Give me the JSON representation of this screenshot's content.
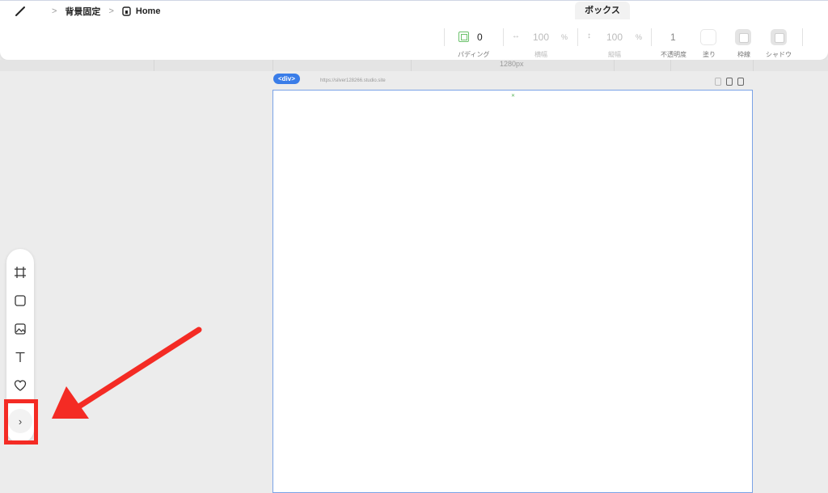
{
  "breadcrumb": {
    "items": [
      "背景固定",
      "Home"
    ]
  },
  "tabs": {
    "active": "ボックス"
  },
  "toolbar": {
    "padding": {
      "value": "0",
      "label": "パディング"
    },
    "width": {
      "value": "100",
      "unit": "%",
      "label": "横幅"
    },
    "height": {
      "value": "100",
      "unit": "%",
      "label": "縦幅"
    },
    "opacity": {
      "value": "1",
      "label": "不透明度"
    },
    "fill": {
      "label": "塗り"
    },
    "border": {
      "label": "枠線"
    },
    "shadow": {
      "label": "シャドウ"
    }
  },
  "ruler": {
    "label": "1280px"
  },
  "canvas": {
    "element_tag": "<div>",
    "url": "https://silver128266.studio.site"
  },
  "palette": {
    "items": [
      "frame-icon",
      "box-icon",
      "image-icon",
      "text-icon",
      "heart-icon"
    ],
    "expand_label": "›"
  },
  "colors": {
    "accent": "#3a7de8",
    "highlight": "#f42b24",
    "padding_icon": "#6cc26c"
  }
}
